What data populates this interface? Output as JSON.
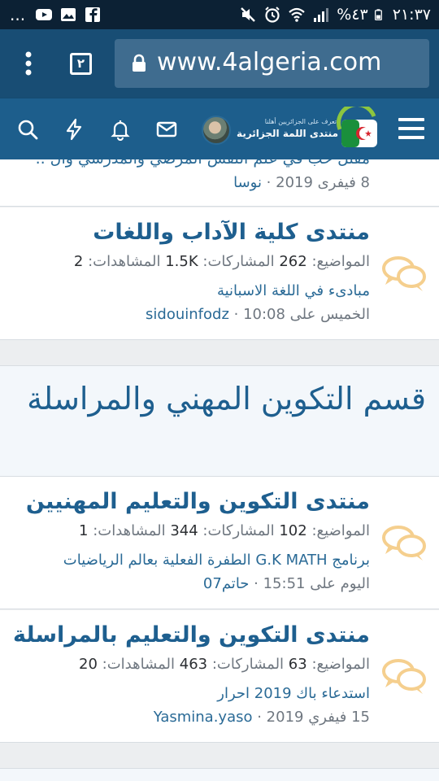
{
  "status_bar": {
    "time": "٢١:٣٧",
    "battery": "%٤٣",
    "dots": "..."
  },
  "browser": {
    "url": "www.4algeria.com",
    "tab_count": "٢"
  },
  "site": {
    "logo_tagline": "تعرف على الجزائريين أهلنا",
    "logo_name": "منتدى اللمة الجزائرية"
  },
  "nodes": [
    {
      "partial_text": "مقتل حب في علم النفس المرضي والمدرسي وال ..",
      "meta_date": "8 فيفرى 2019",
      "meta_user": "نوسا"
    },
    {
      "title": "منتدى كلية الآداب واللغات",
      "topics_label": "المواضيع:",
      "topics": "262",
      "posts_label": "المشاركات:",
      "posts": "1.5K",
      "views_label": "المشاهدات:",
      "views": "2",
      "last_post": "مبادىء في اللغة الاسبانية",
      "meta_date": "الخميس على 10:08",
      "meta_user": "sidouinfodz"
    }
  ],
  "category": {
    "title": "قسم التكوين المهني والمراسلة"
  },
  "category_nodes": [
    {
      "title": "منتدى التكوين والتعليم المهنيين",
      "topics_label": "المواضيع:",
      "topics": "102",
      "posts_label": "المشاركات:",
      "posts": "344",
      "views_label": "المشاهدات:",
      "views": "1",
      "last_post": "برنامج G.K MATH الطفرة الفعلية بعالم الرياضيات",
      "meta_date": "اليوم على 15:51",
      "meta_user": "حاتم07"
    },
    {
      "title": "منتدى التكوين والتعليم بالمراسلة",
      "topics_label": "المواضيع:",
      "topics": "63",
      "posts_label": "المشاركات:",
      "posts": "463",
      "views_label": "المشاهدات:",
      "views": "20",
      "last_post": "استدعاء باك 2019 احرار",
      "meta_date": "15 فيفري 2019",
      "meta_user": "Yasmina.yaso"
    }
  ],
  "colors": {
    "status_bar": "#0c2134",
    "browser_bar": "#184d74",
    "site_header": "#1d5e8c",
    "link": "#1e5f8f",
    "chat_icon": "#f5cf8e"
  },
  "icons": [
    "facebook-icon",
    "gallery-icon",
    "youtube-icon",
    "mute-icon",
    "alarm-icon",
    "wifi-icon",
    "signal-icon",
    "battery-icon",
    "menu-dots-icon",
    "lock-icon",
    "hamburger-icon",
    "search-icon",
    "bolt-icon",
    "bell-icon",
    "envelope-icon",
    "chat-bubbles-icon"
  ]
}
